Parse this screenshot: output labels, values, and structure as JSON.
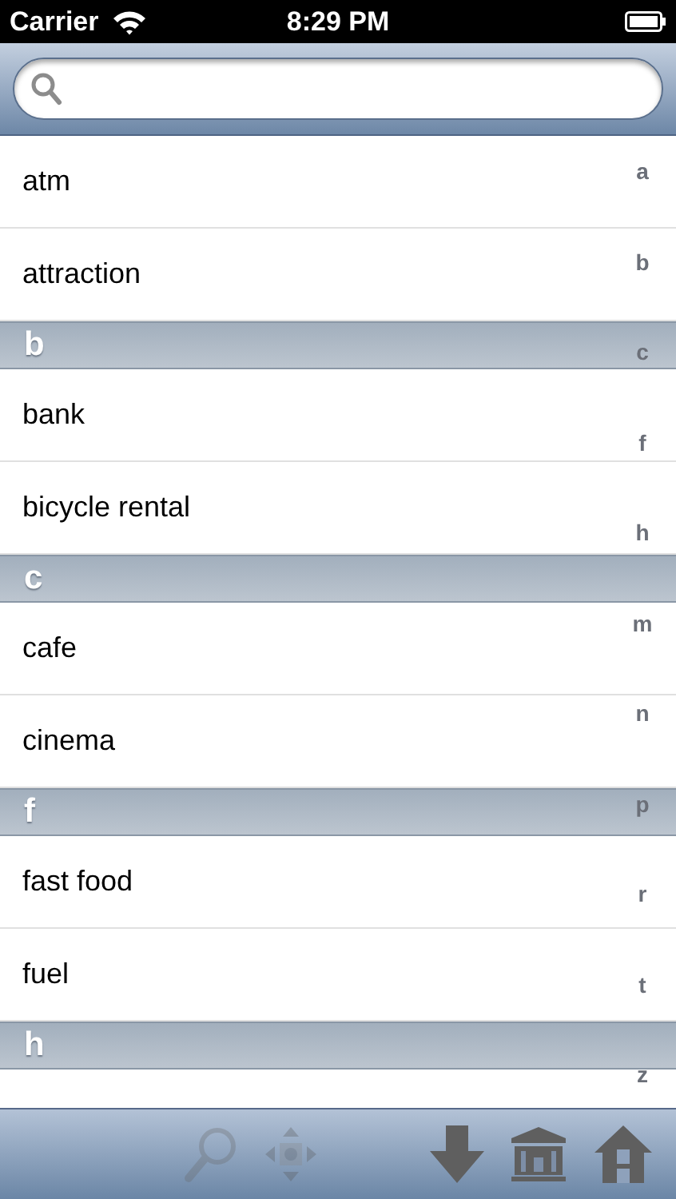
{
  "status_bar": {
    "carrier": "Carrier",
    "time": "8:29 PM"
  },
  "sections": [
    {
      "rows": [
        "atm",
        "attraction"
      ]
    },
    {
      "header": "b",
      "rows": [
        "bank",
        "bicycle rental"
      ]
    },
    {
      "header": "c",
      "rows": [
        "cafe",
        "cinema"
      ]
    },
    {
      "header": "f",
      "rows": [
        "fast food",
        "fuel"
      ]
    },
    {
      "header": "h",
      "rows": [
        ""
      ]
    }
  ],
  "index": [
    "a",
    "b",
    "c",
    "f",
    "h",
    "m",
    "n",
    "p",
    "r",
    "t",
    "z"
  ],
  "toolbar": [
    {
      "kind": "search",
      "disabled": true
    },
    {
      "kind": "move",
      "disabled": true
    },
    {
      "kind": "download",
      "disabled": false
    },
    {
      "kind": "bank",
      "disabled": false
    },
    {
      "kind": "home",
      "disabled": false
    }
  ]
}
